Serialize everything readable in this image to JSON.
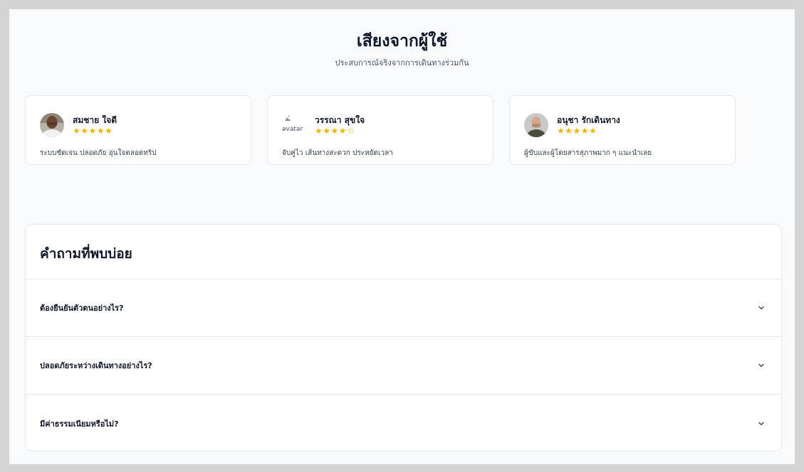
{
  "testimonials": {
    "title": "เสียงจากผู้ใช้",
    "subtitle": "ประสบการณ์จริงจากการเดินทางร่วมกัน",
    "reviews": [
      {
        "name": "สมชาย ใจดี",
        "stars": "★★★★★",
        "text": "ระบบชัดเจน ปลอดภัย อุ่นใจตลอดทริป",
        "avatar_icon": "avatar-man-icon"
      },
      {
        "name": "วรรณา สุขใจ",
        "stars": "★★★★☆",
        "text": "จับคู่ไว เส้นทางสะดวก ประหยัดเวลา",
        "avatar_alt": "avatar",
        "avatar_icon": "broken-image-icon"
      },
      {
        "name": "อนุชา รักเดินทาง",
        "stars": "★★★★★",
        "text": "ผู้ขับและผู้โดยสารสุภาพมาก ๆ แนะนำเลย",
        "avatar_icon": "avatar-man-icon"
      }
    ],
    "colors": {
      "star": "#f5b301"
    }
  },
  "faq": {
    "title": "คำถามที่พบบ่อย",
    "items": [
      {
        "question": "ต้องยืนยันตัวตนอย่างไร?"
      },
      {
        "question": "ปลอดภัยระหว่างเดินทางอย่างไร?"
      },
      {
        "question": "มีค่าธรรมเนียมหรือไม่?"
      }
    ]
  }
}
